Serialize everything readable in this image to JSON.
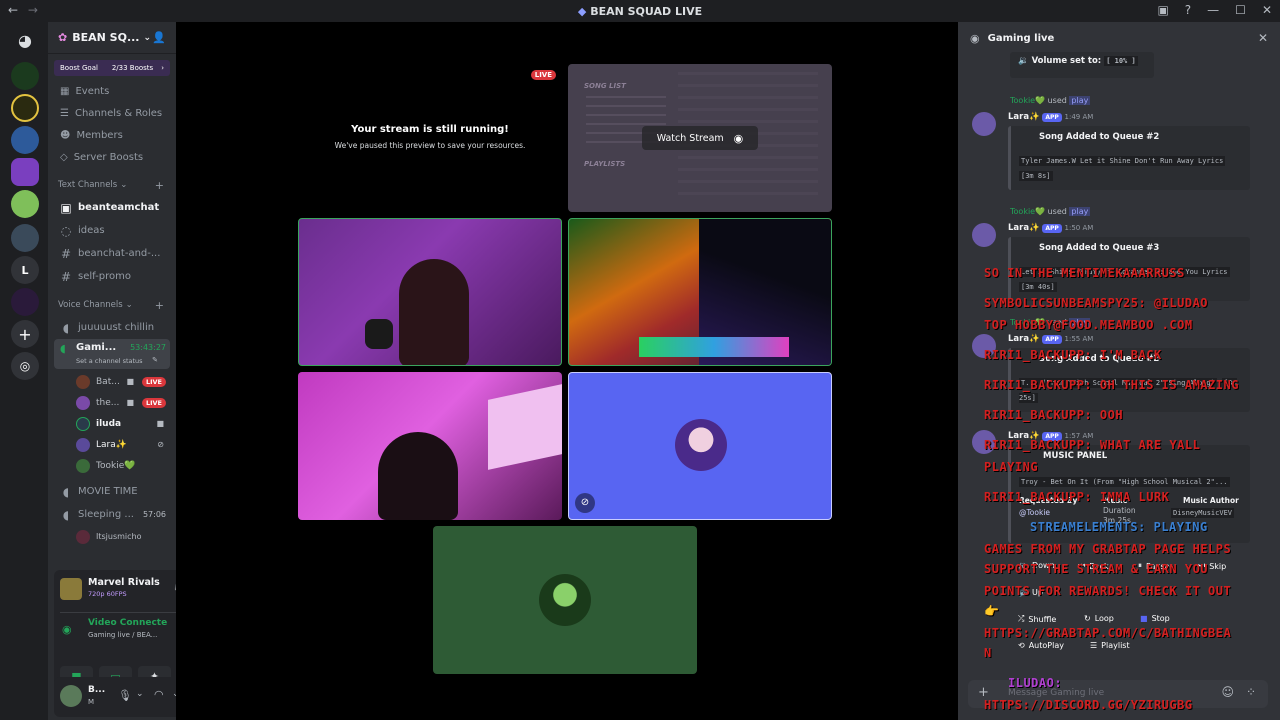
{
  "titlebar": {
    "title": "BEAN SQUAD LIVE"
  },
  "guild_letter": "L",
  "server": {
    "name": "BEAN SQ...",
    "boost_goal": "Boost Goal",
    "boosts": "2/33 Boosts"
  },
  "server_menu": [
    "Events",
    "Channels & Roles",
    "Members",
    "Server Boosts"
  ],
  "text_category": "Text Channels",
  "text_channels": [
    "beanteamchat",
    "ideas",
    "beanchat-and-...",
    "self-promo"
  ],
  "voice_category": "Voice Channels",
  "voice_channels": {
    "first": "juuuuust chillin",
    "gaming": {
      "name": "Gami...",
      "timer": "53:43:27",
      "status": "Set a channel status"
    },
    "users": [
      {
        "name": "Bat...",
        "live": "LIVE"
      },
      {
        "name": "the...",
        "live": "LIVE"
      },
      {
        "name": "iluda",
        "live": ""
      },
      {
        "name": "Lara✨",
        "live": ""
      },
      {
        "name": "Tookie💚",
        "live": ""
      }
    ],
    "movie": "MOVIE TIME",
    "sleeping": {
      "name": "Sleeping ...",
      "timer": "57:06"
    },
    "sleeping_user": "Itsjusmicho"
  },
  "activity": {
    "game": "Marvel Rivals",
    "quality": "720p 60FPS"
  },
  "connection": {
    "status": "Video Connecte",
    "channel": "Gaming live / BEA..."
  },
  "user": {
    "name": "B...",
    "sub": "M"
  },
  "stream": {
    "live_badge": "LIVE",
    "paused_title": "Your stream is still running!",
    "paused_sub": "We've paused this preview to save your resources.",
    "watch_button": "Watch Stream",
    "preview_song_list": "SONG LIST",
    "preview_playlists": "PLAYLISTS"
  },
  "chat": {
    "title": "Gaming live",
    "volume": "Volume set to:",
    "volume_value": "[ 10% ]",
    "messages": [
      {
        "user": "Tookie💚",
        "used": "used",
        "cmd": "play",
        "bot": "Lara✨",
        "app": "APP",
        "time": "1:49 AM",
        "title": "Song Added to Queue #2",
        "song": "Tyler James.W Let it Shine Don't Run Away Lyrics",
        "dur": "[3m 8s]"
      },
      {
        "user": "Tookie💚",
        "used": "used",
        "cmd": "play",
        "bot": "Lara✨",
        "app": "APP",
        "time": "1:50 AM",
        "title": "Song Added to Queue #3",
        "song": "Let It Shine (Krut) ft Roxanne- Me and You Lyrics",
        "dur": "[3m 40s]"
      },
      {
        "user": "Tookie💚",
        "used": "used",
        "cmd": "play",
        "bot": "Lara✨",
        "app": "APP",
        "time": "1:55 AM",
        "title": "Song Added to Queue #2",
        "song": "T... (From \"High School Musical 2\"/Sing-Along)",
        "dur": "[3m 25s]"
      }
    ],
    "panel": {
      "bot": "Lara✨",
      "app": "APP",
      "time": "1:57 AM",
      "title": "MUSIC PANEL",
      "song": "Troy - Bet On It (From \"High School Musical 2\"...",
      "requested_by": "Requested By",
      "requester": "@Tookie",
      "music": "Music",
      "duration_label": "Duration",
      "duration": "3m 25s",
      "author_label": "Music Author",
      "author": "DisneyMusicVEV",
      "buttons": [
        "Down",
        "Back",
        "Pause",
        "Skip",
        "Up",
        "Shuffle",
        "Loop",
        "Stop",
        "AutoPlay",
        "Playlist"
      ]
    },
    "input_placeholder": "Message Gaming live"
  },
  "overlay_lines": [
    "SO IN THE MENTIMEKAAARRUSS",
    "SYMBOLICSUNBEAMSPY25: @ILUDAO",
    "TOP HOBBY@FOOD.MEAMBOO .COM",
    "RIRI1_BACKUPP: I'M BACK",
    "RIRI1_BACKUPP: OH THIS IS AMAZING",
    "RIRI1_BACKUPP: OOH",
    "RIRI1_BACKUPP: WHAT ARE YALL",
    "PLAYING",
    "RIRI1_BACKUPP: IMMA LURK",
    "STREAMELEMENTS: PLAYING",
    "GAMES FROM MY GRABTAP PAGE HELPS",
    "SUPPORT THE STREAM & EARN YOU",
    "POINTS FOR REWARDS! CHECK IT OUT",
    "👉",
    "HTTPS://GRABTAP.COM/C/BATHINGBEA",
    "N",
    "ILUDAO:",
    "HTTPS://DISCORD.GG/YZIRUGBG"
  ],
  "colors": {
    "accent": "#5865f2",
    "live": "#da373c",
    "overlay": "#d32020",
    "green_tile": "#2e5b35",
    "blue_tile": "#5865f2"
  }
}
